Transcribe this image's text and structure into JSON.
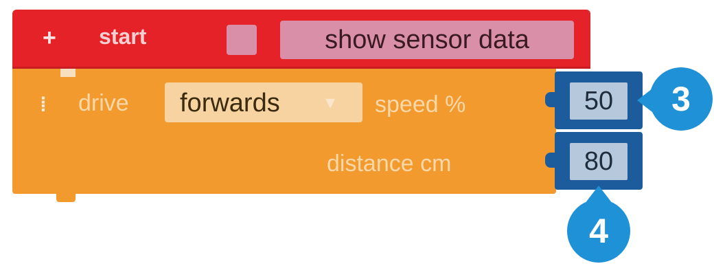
{
  "blocks": {
    "start": {
      "plus": "+",
      "label": "start",
      "sensor_field": "show sensor data"
    },
    "drive": {
      "grip": "⁞",
      "label": "drive",
      "direction": "forwards",
      "dropdown_arrow": "▾",
      "speed_label": "speed %",
      "speed_value": "50",
      "distance_label": "distance cm",
      "distance_value": "80"
    }
  },
  "callouts": {
    "speed": "3",
    "distance": "4"
  },
  "colors": {
    "start_block": "#e42227",
    "drive_block": "#f29a2e",
    "value_slot": "#1c5c9c",
    "callout": "#1f91d6"
  }
}
